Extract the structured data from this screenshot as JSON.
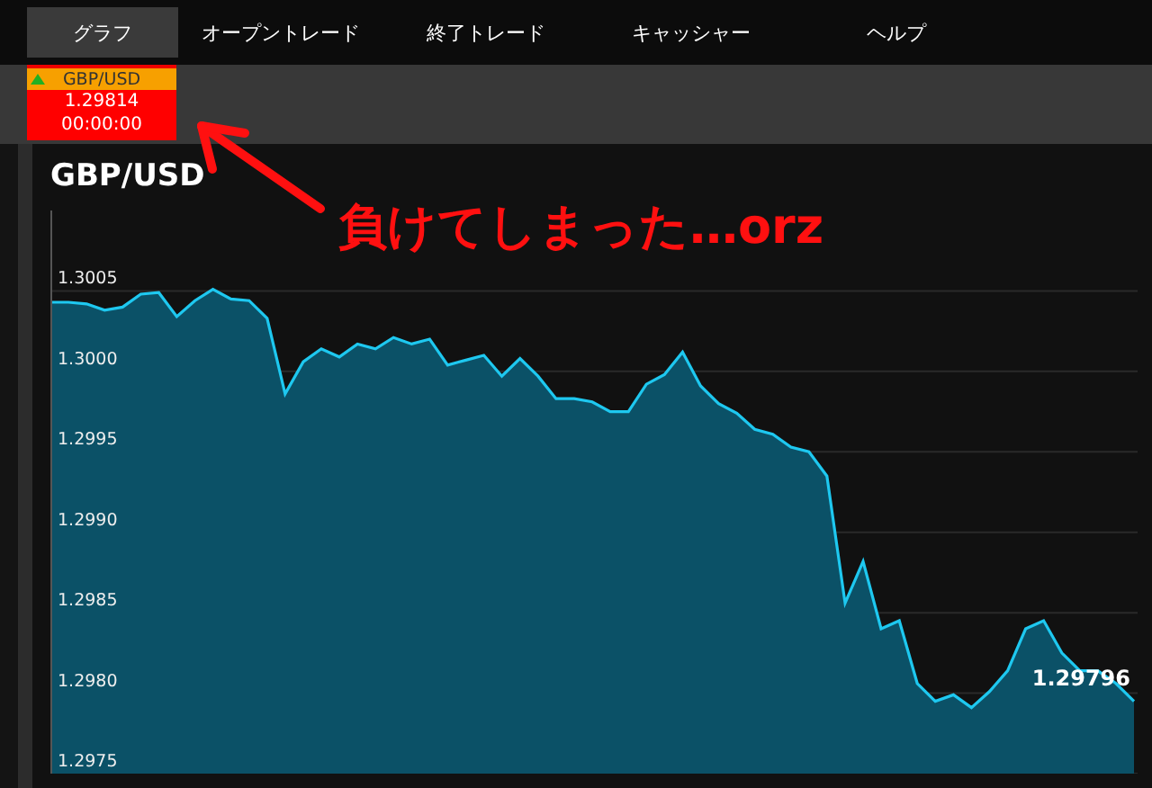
{
  "tabs": [
    {
      "label": "グラフ",
      "selected": true
    },
    {
      "label": "オープントレード",
      "selected": false
    },
    {
      "label": "終了トレード",
      "selected": false
    },
    {
      "label": "キャッシャー",
      "selected": false
    },
    {
      "label": "ヘルプ",
      "selected": false
    }
  ],
  "ticker": {
    "symbol": "GBP/USD",
    "rising": true,
    "price": "1.29814",
    "time": "00:00:00"
  },
  "chart_panel": {
    "title": "GBP/USD",
    "last_price": "1.29796",
    "chart_data": {
      "type": "area",
      "ylim": [
        1.2975,
        1.301
      ],
      "grid": true,
      "yticks": [
        {
          "value": 1.2975,
          "label": "1.2975"
        },
        {
          "value": 1.298,
          "label": "1.2980"
        },
        {
          "value": 1.2985,
          "label": "1.2985"
        },
        {
          "value": 1.299,
          "label": "1.2990"
        },
        {
          "value": 1.2995,
          "label": "1.2995"
        },
        {
          "value": 1.3,
          "label": "1.3000"
        },
        {
          "value": 1.3005,
          "label": "1.3005"
        }
      ],
      "series": [
        {
          "color": "#1ec8f0",
          "values": [
            1.30043,
            1.30043,
            1.30042,
            1.30038,
            1.3004,
            1.30048,
            1.30049,
            1.30034,
            1.30044,
            1.30051,
            1.30045,
            1.30044,
            1.30033,
            1.29986,
            1.30006,
            1.30014,
            1.30009,
            1.30017,
            1.30014,
            1.30021,
            1.30017,
            1.3002,
            1.30004,
            1.30007,
            1.3001,
            1.29997,
            1.30008,
            1.29997,
            1.29983,
            1.29983,
            1.29981,
            1.29975,
            1.29975,
            1.29992,
            1.29998,
            1.30012,
            1.29991,
            1.2998,
            1.29974,
            1.29964,
            1.29961,
            1.29953,
            1.2995,
            1.29935,
            1.29856,
            1.29882,
            1.2984,
            1.29845,
            1.29806,
            1.29795,
            1.29799,
            1.29791,
            1.29801,
            1.29814,
            1.2984,
            1.29845,
            1.29825,
            1.29814,
            1.29814,
            1.29806,
            1.29795
          ]
        }
      ]
    }
  },
  "annotation": {
    "text": "負けてしまった…orz"
  }
}
